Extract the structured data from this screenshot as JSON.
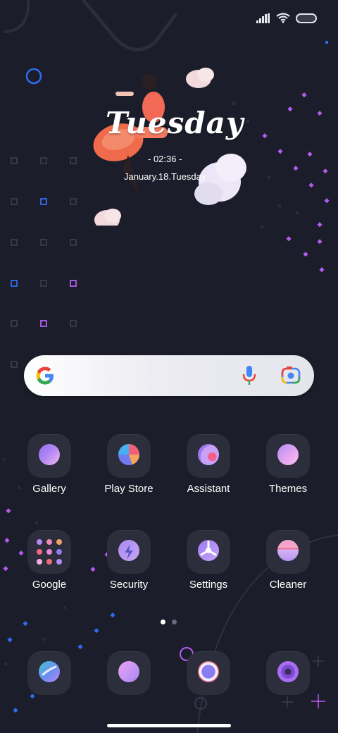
{
  "status_bar": {
    "signal_icon": "signal-bars-icon",
    "wifi_icon": "wifi-icon",
    "battery_icon": "battery-icon"
  },
  "clock_widget": {
    "day_word": "Tuesday",
    "time": "- 02:36 -",
    "date": "January.18.Tuesday"
  },
  "search_bar": {
    "logo_icon": "google-g-icon",
    "voice_icon": "microphone-icon",
    "lens_icon": "camera-lens-icon"
  },
  "apps_row1": [
    {
      "label": "Gallery",
      "icon": "gallery-icon"
    },
    {
      "label": "Play Store",
      "icon": "play-store-icon"
    },
    {
      "label": "Assistant",
      "icon": "assistant-icon"
    },
    {
      "label": "Themes",
      "icon": "themes-icon"
    }
  ],
  "apps_row2": [
    {
      "label": "Google",
      "icon": "google-folder-icon"
    },
    {
      "label": "Security",
      "icon": "security-icon"
    },
    {
      "label": "Settings",
      "icon": "settings-icon"
    },
    {
      "label": "Cleaner",
      "icon": "cleaner-icon"
    }
  ],
  "page_indicator": {
    "pages": 2,
    "current": 1
  },
  "dock": [
    {
      "icon": "phone-icon"
    },
    {
      "icon": "messages-icon"
    },
    {
      "icon": "browser-icon"
    },
    {
      "icon": "camera-icon"
    }
  ],
  "colors": {
    "background": "#1c1d2a",
    "tile": "#2c2e3c",
    "accent_purple": "#b45cf0",
    "accent_blue": "#2f6cf0"
  }
}
